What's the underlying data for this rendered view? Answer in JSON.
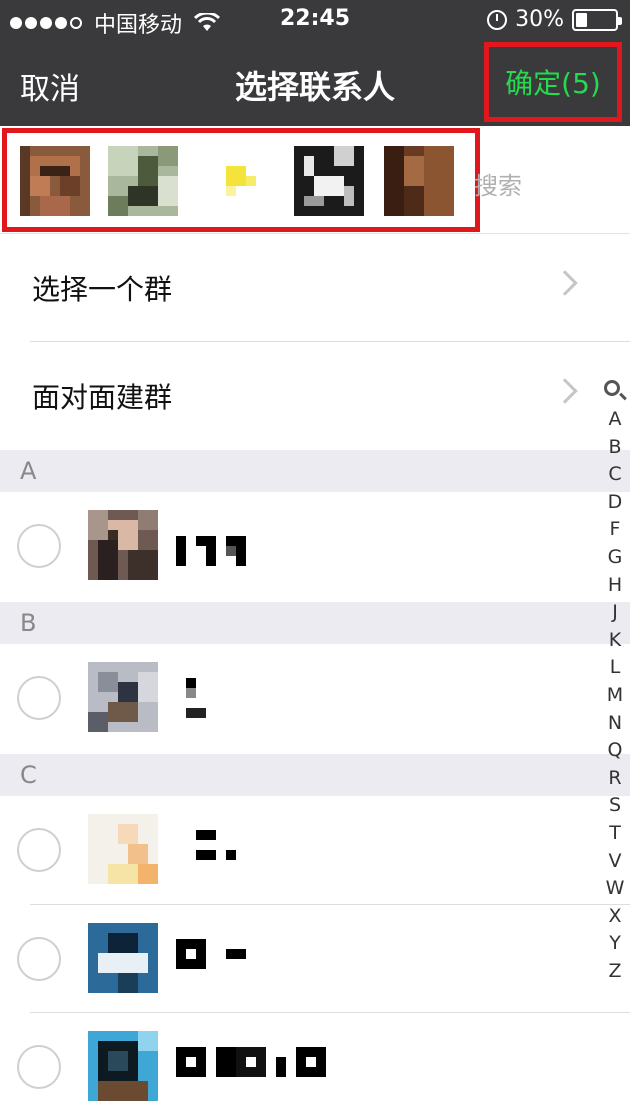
{
  "status_bar": {
    "carrier": "中国移动",
    "time": "22:45",
    "battery": "30%",
    "battery_level": 0.3
  },
  "nav": {
    "cancel_label": "取消",
    "title": "选择联系人",
    "confirm_label": "确定(5)"
  },
  "selected": {
    "search_placeholder": "搜索",
    "count": 5
  },
  "menu": {
    "select_group_label": "选择一个群",
    "face_to_face_label": "面对面建群"
  },
  "sections": [
    {
      "letter": "A"
    },
    {
      "letter": "B"
    },
    {
      "letter": "C"
    }
  ],
  "index": {
    "letters": [
      "A",
      "B",
      "C",
      "D",
      "F",
      "G",
      "H",
      "J",
      "K",
      "L",
      "M",
      "N",
      "Q",
      "R",
      "S",
      "T",
      "V",
      "W",
      "X",
      "Y",
      "Z"
    ]
  },
  "colors": {
    "bar_bg": "#3a3a3c",
    "accent_green": "#26d94f",
    "highlight_red": "#e0171d",
    "section_bg": "#ebebf1"
  }
}
